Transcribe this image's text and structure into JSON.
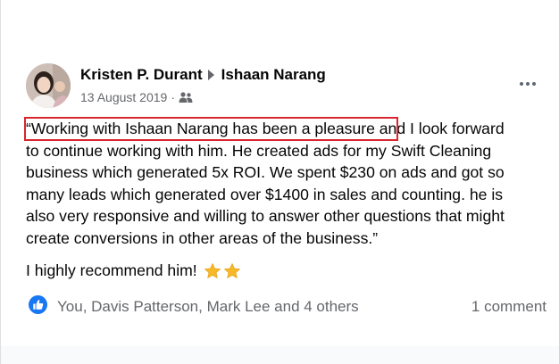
{
  "post": {
    "author": "Kristen P. Durant",
    "recipient": "Ishaan Narang",
    "date": "13 August 2019",
    "separator": "·",
    "audience_icon": "group-icon",
    "more_icon": "more-options-icon",
    "body_lines": [
      "“Working with Ishaan Narang has been a pleasure and I look forward",
      "to continue working with him. He created ads for my Swift Cleaning",
      "business which generated 5x ROI. We spent $230 on ads and got so",
      "many leads which generated over $1400 in sales and counting. he is",
      "also very responsive and willing to answer other questions that might",
      "create conversions in other areas of the business.”"
    ],
    "recommend_text": "I highly recommend him!",
    "star_icon": "star-icon"
  },
  "reactions": {
    "icon": "like-icon",
    "text": "You, Davis Patterson, Mark Lee and 4 others",
    "comments": "1 comment"
  },
  "colors": {
    "highlight": "#d9262e",
    "like_blue": "#1877f2",
    "secondary_text": "#65676b",
    "star": "#f7b928"
  }
}
